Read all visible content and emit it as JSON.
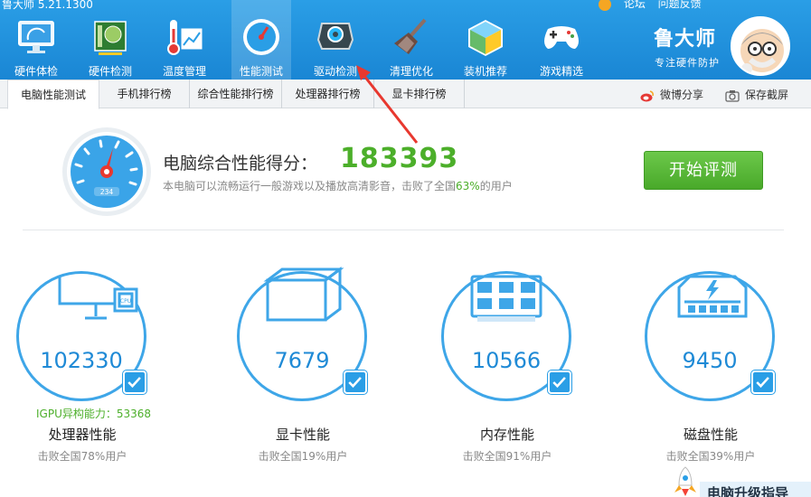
{
  "app": {
    "title": "鲁大师 5.21.1300"
  },
  "topright": {
    "forum": "论坛",
    "feedback": "问题反馈"
  },
  "nav": [
    {
      "label": "硬件体检",
      "icon": "monitor-icon"
    },
    {
      "label": "硬件检测",
      "icon": "motherboard-icon"
    },
    {
      "label": "温度管理",
      "icon": "thermometer-icon"
    },
    {
      "label": "性能测试",
      "icon": "speedometer-icon",
      "active": true
    },
    {
      "label": "驱动检测",
      "icon": "driver-gear-icon"
    },
    {
      "label": "清理优化",
      "icon": "broom-icon"
    },
    {
      "label": "装机推荐",
      "icon": "cube-icon"
    },
    {
      "label": "游戏精选",
      "icon": "gamepad-icon"
    }
  ],
  "brand": {
    "name": "鲁大师",
    "slogan": "专注硬件防护"
  },
  "tabs": [
    {
      "label": "电脑性能测试",
      "active": true
    },
    {
      "label": "手机排行榜"
    },
    {
      "label": "综合性能排行榜"
    },
    {
      "label": "处理器排行榜"
    },
    {
      "label": "显卡排行榜"
    }
  ],
  "tools": {
    "weibo_share": "微博分享",
    "save_screenshot": "保存截屏"
  },
  "score": {
    "label": "电脑综合性能得分：",
    "value": "183393",
    "desc_prefix": "本电脑可以流畅运行一般游戏以及播放高清影音，击败了全国",
    "desc_pct": "63%",
    "desc_suffix": "的用户",
    "gauge_readout": "234"
  },
  "start_button": "开始评测",
  "components": [
    {
      "value": "102330",
      "name": "处理器性能",
      "desc": "击败全国78%用户",
      "icon": "cpu-monitor-icon"
    },
    {
      "value": "7679",
      "name": "显卡性能",
      "desc": "击败全国19%用户",
      "icon": "graphics-cube-icon"
    },
    {
      "value": "10566",
      "name": "内存性能",
      "desc": "击败全国91%用户",
      "icon": "memory-chip-icon"
    },
    {
      "value": "9450",
      "name": "磁盘性能",
      "desc": "击败全国39%用户",
      "icon": "disk-drive-icon"
    }
  ],
  "igpu": "IGPU异构能力：53368",
  "upgrade_guide": "电脑升级指导",
  "colors": {
    "header_blue": "#1a86d4",
    "accent_blue": "#3ea6e8",
    "score_green": "#4caf2a",
    "arrow_red": "#e8382f"
  }
}
